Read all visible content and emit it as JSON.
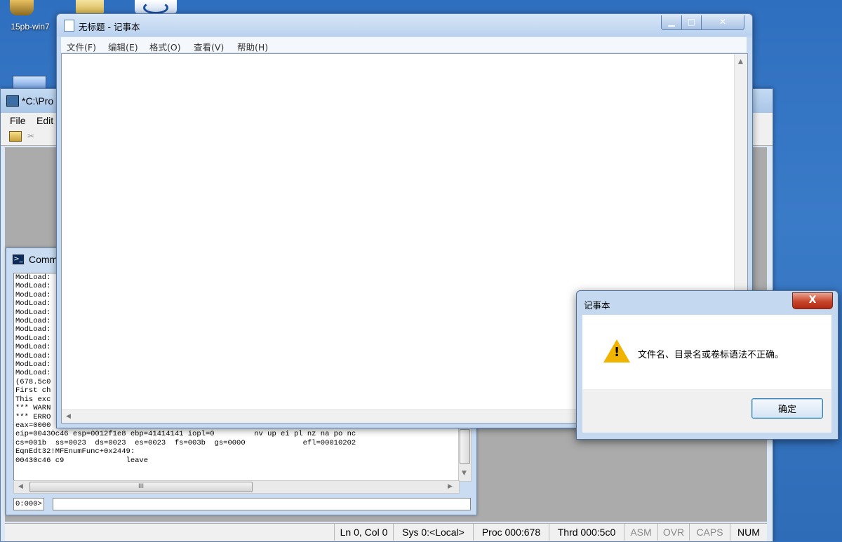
{
  "desktop": {
    "icon_label": "15pb-win7"
  },
  "windbg": {
    "title": "*C:\\Pro",
    "menu": [
      "File",
      "Edit"
    ],
    "status": [
      "Ln 0, Col 0",
      "Sys 0:<Local>",
      "Proc 000:678",
      "Thrd 000:5c0",
      "ASM",
      "OVR",
      "CAPS",
      "NUM"
    ]
  },
  "command_window": {
    "title": "Comm",
    "output_lines": [
      "ModLoad:",
      "ModLoad:",
      "ModLoad:",
      "ModLoad:",
      "ModLoad:",
      "ModLoad:",
      "ModLoad:",
      "ModLoad:",
      "ModLoad:",
      "ModLoad:",
      "ModLoad:",
      "ModLoad:",
      "(678.5c0",
      "First ch",
      "This exc",
      "*** WARN",
      "*** ERRO",
      "eax=0000",
      "eip=00430c46 esp=0012f1e8 ebp=41414141 iopl=0         nv up ei pl nz na po nc",
      "cs=001b  ss=0023  ds=0023  es=0023  fs=003b  gs=0000             efl=00010202",
      "EqnEdt32!MFEnumFunc+0x2449:",
      "00430c46 c9              leave"
    ],
    "hscroll_grip": "III",
    "prompt": "0:000>",
    "input_value": ""
  },
  "notepad": {
    "title": "无标题 - 记事本",
    "menu": [
      "文件(F)",
      "编辑(E)",
      "格式(O)",
      "查看(V)",
      "帮助(H)"
    ],
    "content": ""
  },
  "dialog": {
    "title": "记事本",
    "message": "文件名、目录名或卷标语法不正确。",
    "ok_label": "确定",
    "close_glyph": "X"
  }
}
